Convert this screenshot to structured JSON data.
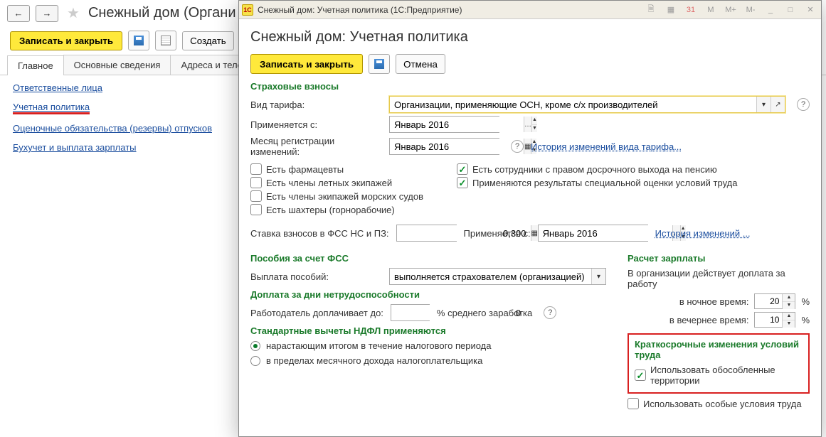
{
  "bg": {
    "title": "Снежный дом (Органи",
    "save_close": "Записать и закрыть",
    "create": "Создать",
    "tabs": [
      "Главное",
      "Основные сведения",
      "Адреса и телефо"
    ],
    "links": {
      "responsible": "Ответственные лица",
      "policy": "Учетная политика",
      "reserves": "Оценочные обязательства (резервы) отпусков",
      "payroll": "Бухучет и выплата зарплаты"
    }
  },
  "dlg": {
    "titlebar": "Снежный дом: Учетная политика   (1С:Предприятие)",
    "title": "Снежный дом: Учетная политика",
    "save_close": "Записать и закрыть",
    "cancel": "Отмена",
    "sec_insurance": "Страховые взносы",
    "tariff_type_lbl": "Вид тарифа:",
    "tariff_type_val": "Организации, применяющие ОСН, кроме с/х производителей",
    "applied_from_lbl": "Применяется с:",
    "applied_from_val": "Январь 2016",
    "reg_month_lbl": "Месяц регистрации изменений:",
    "reg_month_val": "Январь 2016",
    "history_tariff": "История изменений вида тарифа...",
    "chk_pharma": "Есть фармацевты",
    "chk_crew": "Есть члены летных экипажей",
    "chk_ship": "Есть члены экипажей морских судов",
    "chk_miner": "Есть шахтеры (горнорабочие)",
    "chk_early": "Есть сотрудники с правом досрочного выхода на пенсию",
    "chk_spec": "Применяются результаты специальной оценки условий труда",
    "fss_rate_lbl": "Ставка взносов в ФСС НС и ПЗ:",
    "fss_rate_val": "0,300",
    "fss_rate_unit": "",
    "fss_applied_lbl": "Применяется с:",
    "fss_applied_val": "Январь 2016",
    "history_rate": "История изменений ...",
    "sec_benefits": "Пособия за счет ФСС",
    "benefit_pay_lbl": "Выплата пособий:",
    "benefit_pay_val": "выполняется страхователем (организацией)",
    "sec_disability": "Доплата за дни нетрудоспособности",
    "employer_pays_lbl": "Работодатель доплачивает до:",
    "employer_pays_val": "0",
    "employer_pays_unit": "% среднего заработка",
    "sec_ndfl": "Стандартные вычеты НДФЛ применяются",
    "radio_accum": "нарастающим итогом в течение налогового периода",
    "radio_monthly": "в пределах месячного дохода налогоплательщика",
    "sec_salary": "Расчет зарплаты",
    "salary_note": "В организации действует доплата за работу",
    "night_lbl": "в ночное время:",
    "night_val": "20",
    "evening_lbl": "в вечернее время:",
    "evening_val": "10",
    "pct": "%",
    "sec_short": "Краткосрочные изменения условий труда",
    "chk_territory": "Использовать обособленные территории",
    "chk_special": "Использовать особые условия труда"
  }
}
